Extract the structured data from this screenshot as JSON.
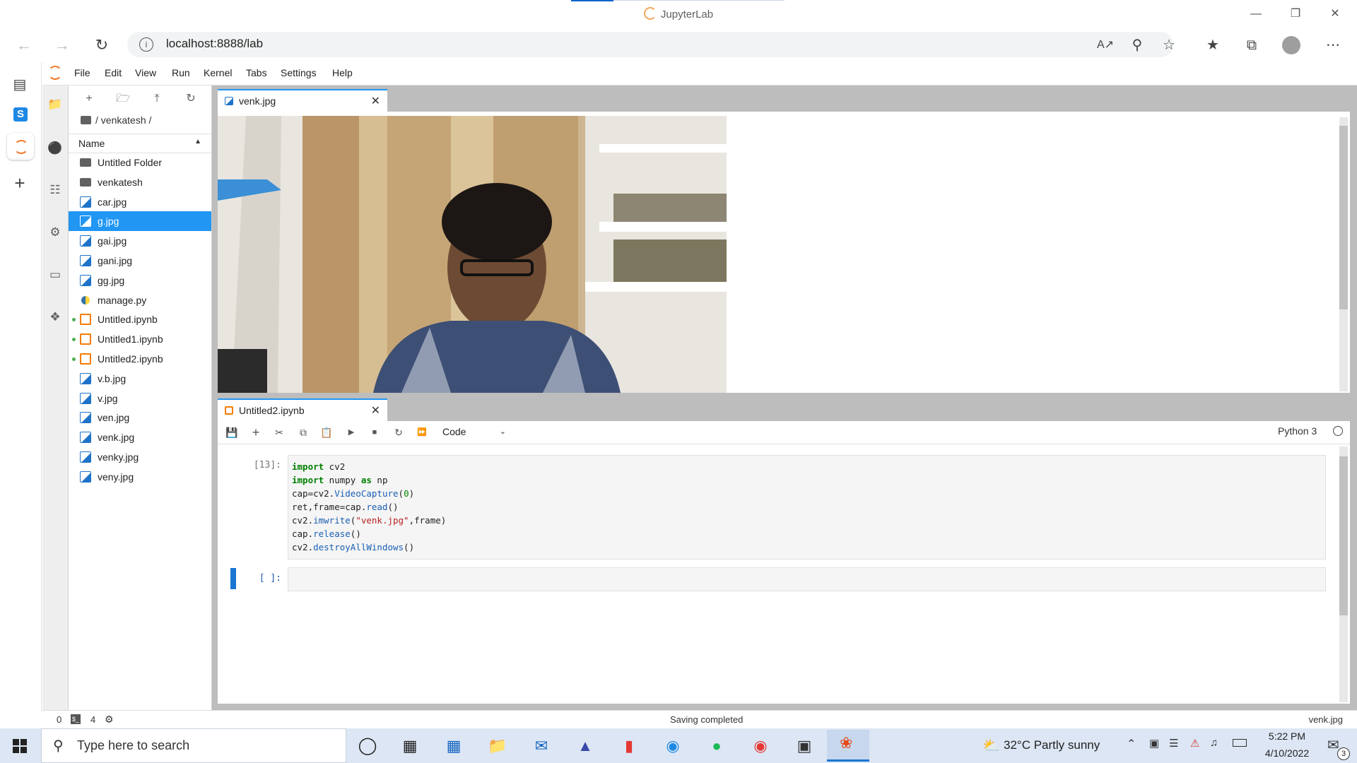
{
  "browser": {
    "window_title": "JupyterLab",
    "url": "localhost:8888/lab"
  },
  "menu": [
    "File",
    "Edit",
    "View",
    "Run",
    "Kernel",
    "Tabs",
    "Settings",
    "Help"
  ],
  "filebrowser": {
    "breadcrumb": "/ venkatesh /",
    "column_name": "Name",
    "files": [
      {
        "name": "Untitled Folder",
        "type": "folder",
        "running": false,
        "selected": false
      },
      {
        "name": "venkatesh",
        "type": "folder",
        "running": false,
        "selected": false
      },
      {
        "name": "car.jpg",
        "type": "image",
        "running": false,
        "selected": false
      },
      {
        "name": "g.jpg",
        "type": "image",
        "running": false,
        "selected": true
      },
      {
        "name": "gai.jpg",
        "type": "image",
        "running": false,
        "selected": false
      },
      {
        "name": "gani.jpg",
        "type": "image",
        "running": false,
        "selected": false
      },
      {
        "name": "gg.jpg",
        "type": "image",
        "running": false,
        "selected": false
      },
      {
        "name": "manage.py",
        "type": "python",
        "running": false,
        "selected": false
      },
      {
        "name": "Untitled.ipynb",
        "type": "notebook",
        "running": true,
        "selected": false
      },
      {
        "name": "Untitled1.ipynb",
        "type": "notebook",
        "running": true,
        "selected": false
      },
      {
        "name": "Untitled2.ipynb",
        "type": "notebook",
        "running": true,
        "selected": false
      },
      {
        "name": "v.b.jpg",
        "type": "image",
        "running": false,
        "selected": false
      },
      {
        "name": "v.jpg",
        "type": "image",
        "running": false,
        "selected": false
      },
      {
        "name": "ven.jpg",
        "type": "image",
        "running": false,
        "selected": false
      },
      {
        "name": "venk.jpg",
        "type": "image",
        "running": false,
        "selected": false
      },
      {
        "name": "venky.jpg",
        "type": "image",
        "running": false,
        "selected": false
      },
      {
        "name": "veny.jpg",
        "type": "image",
        "running": false,
        "selected": false
      }
    ]
  },
  "image_tab": {
    "label": "venk.jpg"
  },
  "notebook_tab": {
    "label": "Untitled2.ipynb",
    "cell_type": "Code",
    "kernel": "Python 3",
    "cell1_prompt": "[13]:",
    "cell2_prompt": "[ ]:"
  },
  "status": {
    "left_num1": "0",
    "left_num2": "4",
    "message": "Saving completed",
    "right": "venk.jpg"
  },
  "taskbar": {
    "search_placeholder": "Type here to search",
    "weather": "32°C  Partly sunny",
    "time": "5:22 PM",
    "date": "4/10/2022",
    "notification_count": "3"
  },
  "colors": {
    "accent": "#2196f3",
    "jupyter_orange": "#f37726",
    "taskbar": "#dce6f4"
  }
}
